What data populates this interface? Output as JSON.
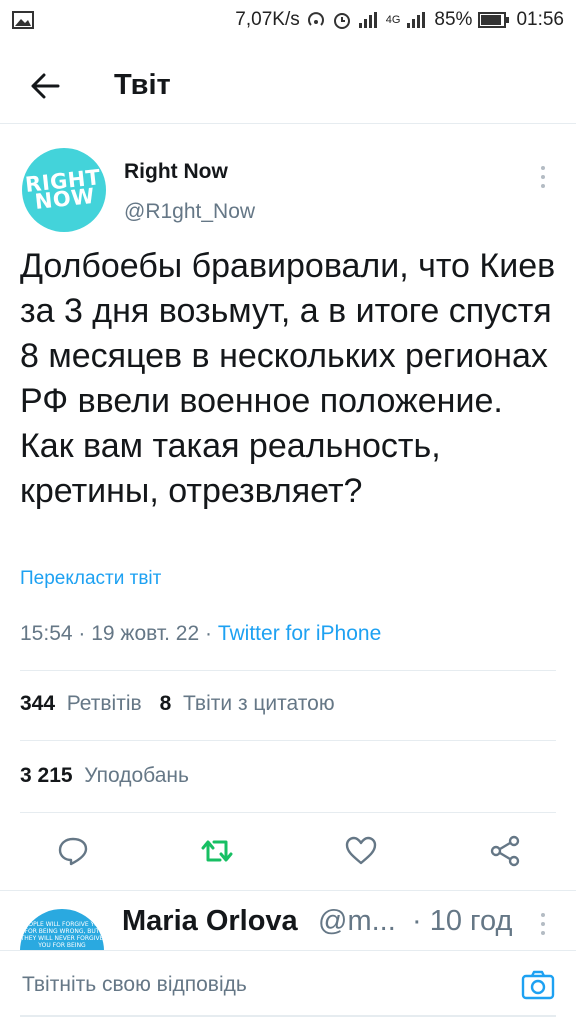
{
  "status_bar": {
    "speed": "7,07K/s",
    "network": "4G",
    "battery": "85%",
    "time": "01:56",
    "icons": [
      "image-icon",
      "hotspot-icon",
      "alarm-icon",
      "signal-icon",
      "battery-icon"
    ]
  },
  "header": {
    "title": "Твіт"
  },
  "tweet": {
    "author_name": "Right Now",
    "author_handle": "@R1ght_Now",
    "avatar_text_line1": "RIGHT",
    "avatar_text_line2": "NOW",
    "text": "Долбоебы бравировали, что Киев за 3 дня возьмут, а в итоге спустя 8 месяцев в нескольких регионах РФ ввели военное положение. Как вам такая реальность, кретины, отрезвляет?",
    "translate_label": "Перекласти твіт",
    "time": "15:54",
    "date": "19 жовт. 22",
    "source": "Twitter for iPhone",
    "retweets_count": "344",
    "retweets_label": "Ретвітів",
    "quotes_count": "8",
    "quotes_label": "Твіти з цитатою",
    "likes_count": "3 215",
    "likes_label": "Уподобань"
  },
  "reply_preview": {
    "name": "Maria Orlova",
    "handle": "@m...",
    "time": "· 10 год",
    "avatar_text": "PEOPLE WILL FORGIVE YOU FOR BEING WRONG, BUT THEY WILL NEVER FORGIVE YOU FOR BEING"
  },
  "compose": {
    "placeholder": "Твітніть свою відповідь"
  },
  "colors": {
    "accent": "#1da1f2",
    "retweet": "#17bf63",
    "text": "#14171a",
    "muted": "#657786",
    "avatar": "#43d3da"
  }
}
